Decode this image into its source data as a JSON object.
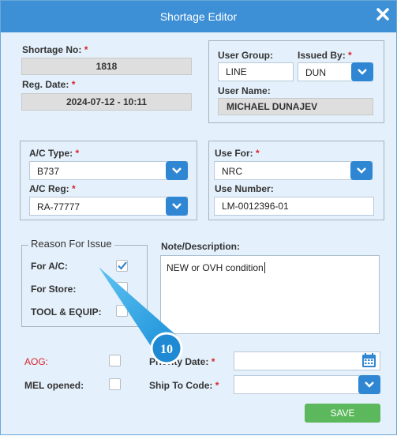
{
  "window": {
    "title": "Shortage Editor",
    "close_icon": "close-icon"
  },
  "header": {
    "shortage_no_label": "Shortage No:",
    "shortage_no_value": "1818",
    "reg_date_label": "Reg. Date:",
    "reg_date_value": "2024-07-12 - 10:11",
    "user_group_label": "User Group:",
    "user_group_value": "LINE",
    "issued_by_label": "Issued By:",
    "issued_by_value": "DUN",
    "user_name_label": "User Name:",
    "user_name_value": "MICHAEL DUNAJEV"
  },
  "aircraft": {
    "ac_type_label": "A/C Type:",
    "ac_type_value": "B737",
    "ac_reg_label": "A/C Reg:",
    "ac_reg_value": "RA-77777",
    "use_for_label": "Use For:",
    "use_for_value": "NRC",
    "use_number_label": "Use Number:",
    "use_number_value": "LM-0012396-01"
  },
  "reason": {
    "legend": "Reason For Issue",
    "for_ac_label": "For A/C:",
    "for_ac_checked": true,
    "for_store_label": "For Store:",
    "for_store_checked": false,
    "tool_label": "TOOL & EQUIP:",
    "tool_checked": false
  },
  "note": {
    "label": "Note/Description:",
    "value": "NEW or OVH condition"
  },
  "bottom": {
    "aog_label": "AOG:",
    "aog_checked": false,
    "mel_label": "MEL opened:",
    "mel_checked": false,
    "priority_date_label": "Priority Date:",
    "priority_date_value": "",
    "ship_to_label": "Ship To Code:",
    "ship_to_value": "",
    "save_label": "SAVE"
  },
  "callout": {
    "number": "10"
  },
  "colors": {
    "titlebar": "#3d8fd6",
    "panel": "#e4f0fb",
    "dropdown_button": "#2f86d2",
    "save_button": "#5cb85c",
    "required": "#d9242b",
    "aog_label": "#d9242b",
    "callout": "#29a3e6"
  },
  "req_mark": "*"
}
